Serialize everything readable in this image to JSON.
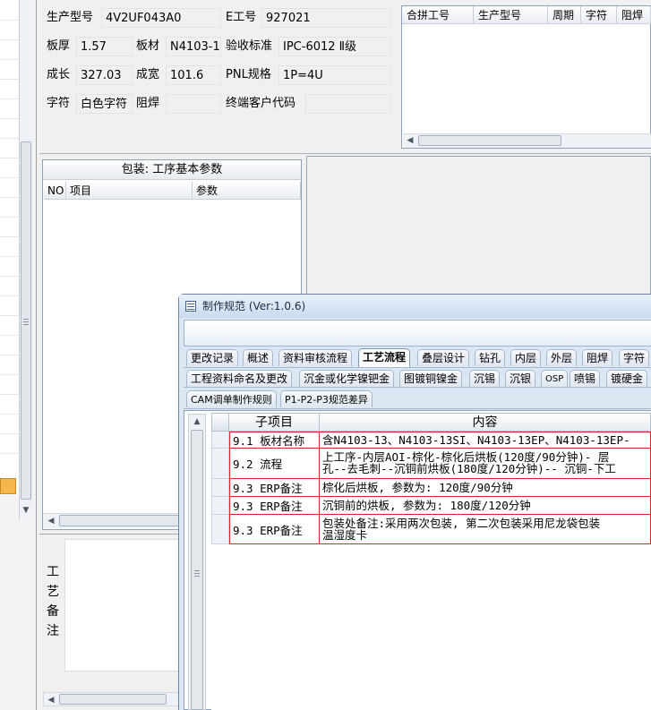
{
  "form": {
    "product_model_label": "生产型号",
    "product_model_value": "4V2UF043A0",
    "e_number_label": "E工号",
    "e_number_value": "927021",
    "thickness_label": "板厚",
    "thickness_value": "1.57",
    "material_label": "板材",
    "material_value": "N4103-1",
    "acceptance_label": "验收标准",
    "acceptance_value": "IPC-6012 Ⅱ级",
    "length_label": "成长",
    "length_value": "327.03",
    "width_label": "成宽",
    "width_value": "101.6",
    "pnl_label": "PNL规格",
    "pnl_value": "1P=4U",
    "legend_label": "字符",
    "legend_value": "白色字符",
    "solder_mask_label": "阻焊",
    "solder_mask_value": "",
    "end_customer_label": "终端客户代码",
    "end_customer_value": ""
  },
  "top_grid": {
    "columns": [
      "合拼工号",
      "生产型号",
      "周期",
      "字符",
      "阻焊"
    ]
  },
  "pack_panel": {
    "title": "包装: 工序基本参数",
    "columns": [
      "NO",
      "项目",
      "参数"
    ]
  },
  "remarks": {
    "label_chars": [
      "工",
      "艺",
      "备",
      "注"
    ],
    "value": ""
  },
  "dialog": {
    "title": "制作规范 (Ver:1.0.6)",
    "tabs_row1": [
      "更改记录",
      "概述",
      "资料审核流程",
      "工艺流程",
      "叠层设计",
      "钻孔",
      "内层",
      "外层",
      "阻焊",
      "字符"
    ],
    "active_tab": "工艺流程",
    "tabs_row2": [
      "工程资料命名及更改",
      "沉金或化学镍钯金",
      "图镀铜镍金",
      "沉锡",
      "沉银",
      "OSP",
      "喷锡",
      "镀硬金"
    ],
    "tabs_row3": [
      "CAM调单制作规则",
      "P1-P2-P3规范差异"
    ],
    "grid_headers": [
      "子项目",
      "内容"
    ],
    "rows": [
      {
        "sub": "9.1 板材名称",
        "content": [
          "含N4103-13、N4103-13SI、N4103-13EP、N4103-13EP-"
        ]
      },
      {
        "sub": "9.2 流程",
        "content": [
          "上工序-内层AOI-棕化-棕化后烘板(120度/90分钟)- 层",
          "孔--去毛刺--沉铜前烘板(180度/120分钟)-- 沉铜-下工"
        ]
      },
      {
        "sub": "9.3 ERP备注",
        "content": [
          "棕化后烘板, 参数为: 120度/90分钟"
        ]
      },
      {
        "sub": "9.3 ERP备注",
        "content": [
          "沉铜前的烘板, 参数为: 180度/120分钟"
        ]
      },
      {
        "sub": "9.3 ERP备注",
        "content": [
          "包装处备注:采用两次包装, 第二次包装采用尼龙袋包装",
          "温湿度卡"
        ]
      }
    ]
  }
}
